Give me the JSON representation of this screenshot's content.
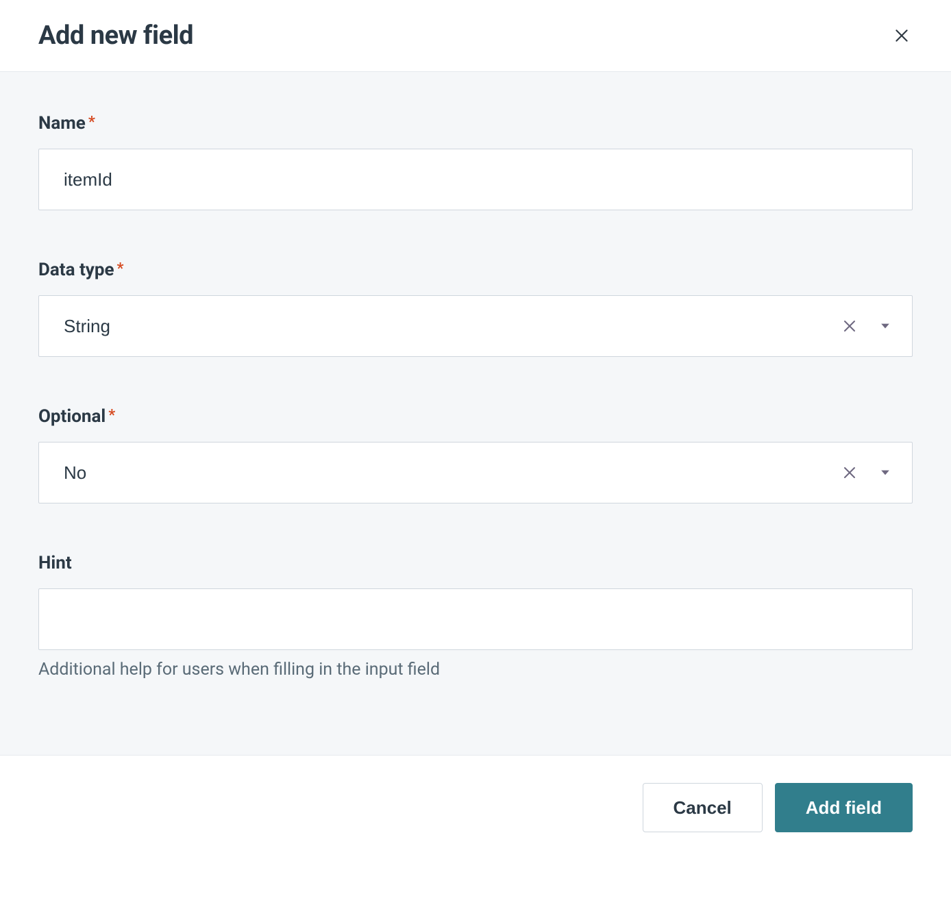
{
  "header": {
    "title": "Add new field"
  },
  "form": {
    "name": {
      "label": "Name",
      "required": true,
      "value": "itemId"
    },
    "data_type": {
      "label": "Data type",
      "required": true,
      "value": "String"
    },
    "optional": {
      "label": "Optional",
      "required": true,
      "value": "No"
    },
    "hint": {
      "label": "Hint",
      "required": false,
      "value": "",
      "help": "Additional help for users when filling in the input field"
    }
  },
  "footer": {
    "cancel": "Cancel",
    "submit": "Add field"
  },
  "required_mark": "*"
}
